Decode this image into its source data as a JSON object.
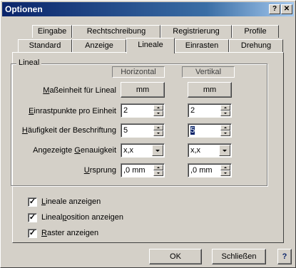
{
  "window": {
    "title": "Optionen",
    "help_btn": "?",
    "close_btn": "✕"
  },
  "tabs": {
    "row_top": [
      "Eingabe",
      "Rechtschreibung",
      "Registrierung",
      "Profile"
    ],
    "row_bottom": [
      "Standard",
      "Anzeige",
      "Lineale",
      "Einrasten",
      "Drehung"
    ],
    "active": "Lineale"
  },
  "group": {
    "label": "Lineal",
    "col_horizontal": "Horizontal",
    "col_vertical": "Vertikal"
  },
  "rows": {
    "masseinheit": {
      "label_pre": "",
      "label_u": "M",
      "label_post": "aßeinheit für Lineal",
      "h": "mm",
      "v": "mm"
    },
    "einrast": {
      "label_pre": "",
      "label_u": "E",
      "label_post": "inrastpunkte pro Einheit",
      "h": "2",
      "v": "2"
    },
    "haeufigkeit": {
      "label_pre": "",
      "label_u": "H",
      "label_post": "äufigkeit der Beschriftung",
      "h": "5",
      "v": "5"
    },
    "genauigkeit": {
      "label_pre": "Angezeigte ",
      "label_u": "G",
      "label_post": "enauigkeit",
      "h": "x,x",
      "v": "x,x"
    },
    "ursprung": {
      "label_pre": "",
      "label_u": "U",
      "label_post": "rsprung",
      "h": ",0 mm",
      "v": ",0 mm"
    }
  },
  "checkboxes": {
    "lineale": {
      "pre": "",
      "u": "L",
      "post": "ineale anzeigen",
      "checked": "✓"
    },
    "linealpos": {
      "pre": "Lineal",
      "u": "p",
      "post": "osition anzeigen",
      "checked": "✓"
    },
    "raster": {
      "pre": "",
      "u": "R",
      "post": "aster anzeigen",
      "checked": "✓"
    }
  },
  "buttons": {
    "ok": "OK",
    "close": "Schließen",
    "help": "?"
  }
}
